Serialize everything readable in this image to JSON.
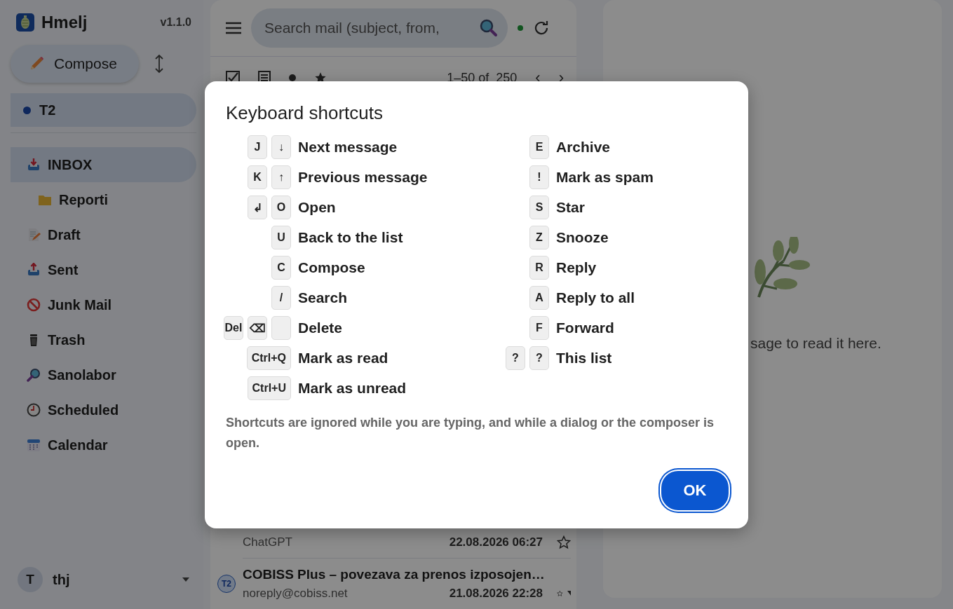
{
  "sidebar": {
    "app_name": "Hmelj",
    "version": "v1.1.0",
    "compose_button": "Compose",
    "accounts": [
      {
        "label": "T2",
        "selected": true
      }
    ],
    "folders": [
      {
        "label": "INBOX",
        "kind": "inbox",
        "selected": true,
        "children": [
          {
            "label": "Reporti",
            "kind": "folder",
            "selected": false
          }
        ]
      },
      {
        "label": "Draft",
        "kind": "draft",
        "selected": false
      },
      {
        "label": "Sent",
        "kind": "sent",
        "selected": false
      },
      {
        "label": "Junk Mail",
        "kind": "junk",
        "selected": false
      },
      {
        "label": "Trash",
        "kind": "trash",
        "selected": false
      },
      {
        "label": "Sanolabor",
        "kind": "search",
        "selected": false
      },
      {
        "label": "Scheduled",
        "kind": "scheduled",
        "selected": false
      },
      {
        "label": "Calendar",
        "kind": "calendar",
        "selected": false
      }
    ],
    "user": {
      "initial": "T",
      "name": "thj"
    }
  },
  "mail": {
    "search": {
      "placeholder": "Search mail (subject, from,"
    },
    "toolbar": {
      "range": "1–50 of  250",
      "prev": "‹",
      "next": "›"
    },
    "messages": [
      {
        "sender": "ChatGPT",
        "date": "22.08.2026 06:27",
        "starred": false
      },
      {
        "account": "T2",
        "subject": "COBISS Plus – povezava za prenos izposojen…",
        "sender": "noreply@cobiss.net",
        "date": "21.08.2026 22:28",
        "starred": false
      }
    ]
  },
  "reading_pane": {
    "empty_text": "sage to read it here."
  },
  "dialog": {
    "title": "Keyboard shortcuts",
    "columns": [
      [
        {
          "keys": [
            "J",
            "↓"
          ],
          "label": "Next message"
        },
        {
          "keys": [
            "K",
            "↑"
          ],
          "label": "Previous message"
        },
        {
          "keys": [
            "↲",
            "O"
          ],
          "label": "Open"
        },
        {
          "keys": [
            "U"
          ],
          "label": "Back to the list"
        },
        {
          "keys": [
            "C"
          ],
          "label": "Compose"
        },
        {
          "keys": [
            "/"
          ],
          "label": "Search"
        },
        {
          "keys": [
            "Del",
            "⌫"
          ],
          "label": "Delete",
          "overflow_key": true
        },
        {
          "keys": [
            "Ctrl+Q"
          ],
          "label": "Mark as read"
        },
        {
          "keys": [
            "Ctrl+U"
          ],
          "label": "Mark as unread"
        }
      ],
      [
        {
          "keys": [
            "E"
          ],
          "label": "Archive"
        },
        {
          "keys": [
            "!"
          ],
          "label": "Mark as spam"
        },
        {
          "keys": [
            "S"
          ],
          "label": "Star"
        },
        {
          "keys": [
            "Z"
          ],
          "label": "Snooze"
        },
        {
          "keys": [
            "R"
          ],
          "label": "Reply"
        },
        {
          "keys": [
            "A"
          ],
          "label": "Reply to all"
        },
        {
          "keys": [
            "F"
          ],
          "label": "Forward"
        },
        {
          "keys": [
            "?",
            "?"
          ],
          "label": "This list"
        }
      ]
    ],
    "note": "Shortcuts are ignored while you are typing, and while a dialog or the composer is open.",
    "ok_button": "OK"
  }
}
